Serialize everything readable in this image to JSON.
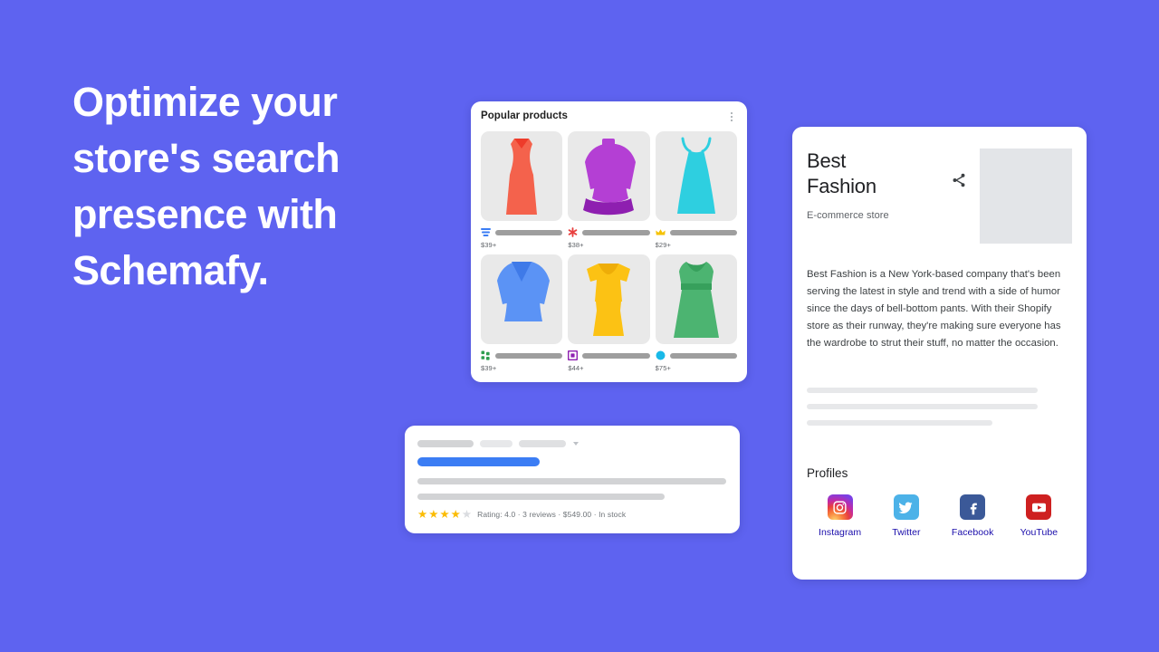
{
  "theme": {
    "background": "#5e63f0",
    "card_background": "#ffffff",
    "link_color": "#1a0dab",
    "star_color": "#fbbc04",
    "snippet_blue": "#3b7df4"
  },
  "headline": {
    "text": "Optimize your store's search presence with Schemafy."
  },
  "products_card": {
    "title": "Popular products",
    "menu_icon": "kebab-menu-icon",
    "items": [
      {
        "name": "red-sheath-dress",
        "price": "$39+",
        "color": "#f4624c",
        "shape": "sheath-dress",
        "brand_icon": "blue-stripes-icon"
      },
      {
        "name": "purple-tunic-top",
        "price": "$38+",
        "color": "#b43fd4",
        "shape": "long-sleeve-tunic",
        "brand_icon": "red-asterisk-icon"
      },
      {
        "name": "cyan-slip-dress",
        "price": "$29+",
        "color": "#2ecfe0",
        "shape": "camisole-dress",
        "brand_icon": "gold-crown-icon"
      },
      {
        "name": "blue-cardigan-dress",
        "price": "$39+",
        "color": "#5b93f5",
        "shape": "v-neck-coat",
        "brand_icon": "green-dots-icon"
      },
      {
        "name": "yellow-peplum-dress",
        "price": "$44+",
        "color": "#fcc214",
        "shape": "peplum-dress",
        "brand_icon": "purple-square-icon"
      },
      {
        "name": "green-a-line-dress",
        "price": "$75+",
        "color": "#4cb471",
        "shape": "a-line-dress",
        "brand_icon": "cyan-circle-icon"
      }
    ]
  },
  "snippet_card": {
    "rating_line": "Rating: 4.0  ·  3 reviews  ·  $549.00  ·  In stock",
    "rating_value": 4.0,
    "stars_total": 5,
    "stars_filled": 4,
    "reviews": "3 reviews",
    "price": "$549.00",
    "availability": "In stock",
    "dropdown_icon": "chevron-down-icon"
  },
  "knowledge_panel": {
    "title": "Best Fashion",
    "subtitle": "E-commerce store",
    "share_icon": "share-icon",
    "description": "Best Fashion is a New York-based company that's been serving the latest in style and trend with a side of humor since the days of bell-bottom pants. With their Shopify store as their runway, they're making sure everyone has the wardrobe to strut their stuff, no matter the occasion.",
    "profiles_title": "Profiles",
    "profiles": [
      {
        "label": "Instagram",
        "icon": "instagram-icon"
      },
      {
        "label": "Twitter",
        "icon": "twitter-icon"
      },
      {
        "label": "Facebook",
        "icon": "facebook-icon"
      },
      {
        "label": "YouTube",
        "icon": "youtube-icon"
      }
    ]
  }
}
